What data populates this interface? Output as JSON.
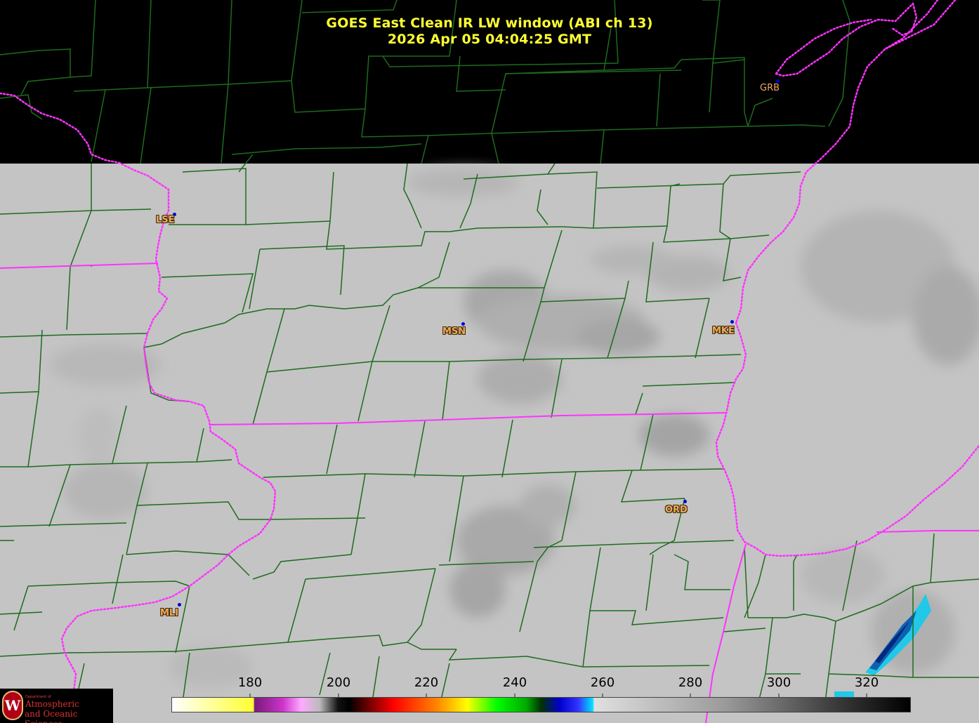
{
  "title": {
    "line1": "GOES East Clean IR LW window (ABI ch 13)",
    "line2": "2026 Apr 05  04:04:25 GMT"
  },
  "stations": [
    {
      "id": "GRB",
      "label": "GRB"
    },
    {
      "id": "LSE",
      "label": "LSE"
    },
    {
      "id": "MSN",
      "label": "MSN"
    },
    {
      "id": "MKE",
      "label": "MKE"
    },
    {
      "id": "ORD",
      "label": "ORD"
    },
    {
      "id": "MLI",
      "label": "MLI"
    }
  ],
  "colorbar": {
    "ticks": [
      "180",
      "200",
      "220",
      "240",
      "260",
      "280",
      "300",
      "320"
    ],
    "colors": {
      "warm": "#ffffff",
      "yellow": "#ffff33",
      "magenta": "#cc33cc",
      "red": "#ff0000",
      "green": "#00ff00",
      "blue": "#0000cc",
      "cyan": "#00e5ff",
      "gray": "#c8c8c8",
      "black": "#000000"
    }
  },
  "logo": {
    "dept": "Department of",
    "line1": "Atmospheric",
    "line2": "and Oceanic Sciences",
    "seal": "W"
  },
  "map_colors": {
    "background_top": "#000000",
    "cloudfree_gray": "#c4c4c4",
    "county_lines": "#1e6b1e",
    "state_borders": "#ff33ff"
  }
}
